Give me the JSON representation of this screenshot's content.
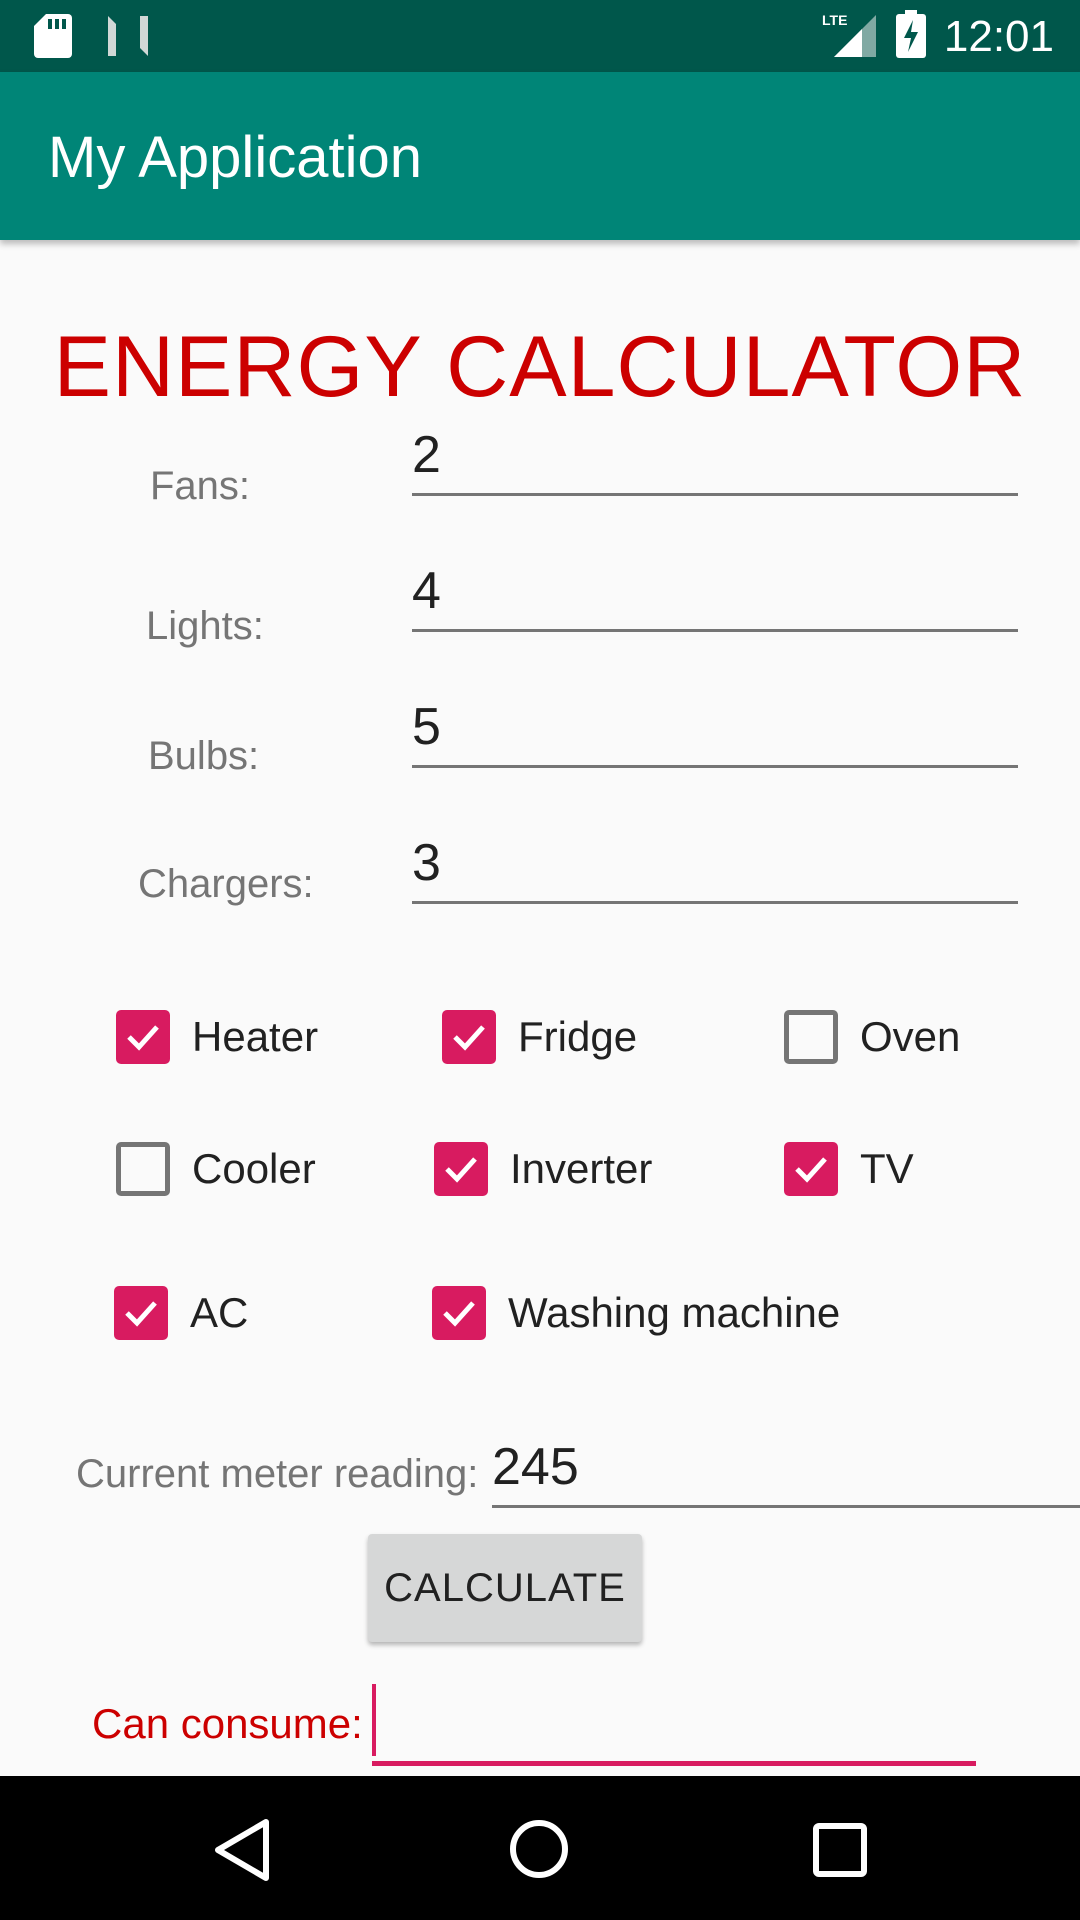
{
  "status_bar": {
    "time": "12:01",
    "network": "LTE"
  },
  "app_bar": {
    "title": "My Application"
  },
  "heading": "ENERGY CALCULATOR",
  "inputs": [
    {
      "label": "Fans:",
      "value": "2"
    },
    {
      "label": "Lights:",
      "value": "4"
    },
    {
      "label": "Bulbs:",
      "value": "5"
    },
    {
      "label": "Chargers:",
      "value": "3"
    }
  ],
  "checkboxes": [
    {
      "label": "Heater",
      "checked": true
    },
    {
      "label": "Fridge",
      "checked": true
    },
    {
      "label": "Oven",
      "checked": false
    },
    {
      "label": "Cooler",
      "checked": false
    },
    {
      "label": "Inverter",
      "checked": true
    },
    {
      "label": "TV",
      "checked": true
    },
    {
      "label": "AC",
      "checked": true
    },
    {
      "label": "Washing machine",
      "checked": true
    }
  ],
  "meter": {
    "label": "Current meter reading:",
    "value": "245"
  },
  "calculate_button": "CALCULATE",
  "result": {
    "label": "Can consume:",
    "value": ""
  },
  "colors": {
    "status_bar": "#00574b",
    "app_bar": "#008577",
    "accent": "#d81b60",
    "heading": "#cc0000"
  },
  "icons": [
    "sd-card-icon",
    "n-notification-icon",
    "lte-signal-icon",
    "battery-charging-icon",
    "back-icon",
    "home-icon",
    "recents-icon"
  ]
}
